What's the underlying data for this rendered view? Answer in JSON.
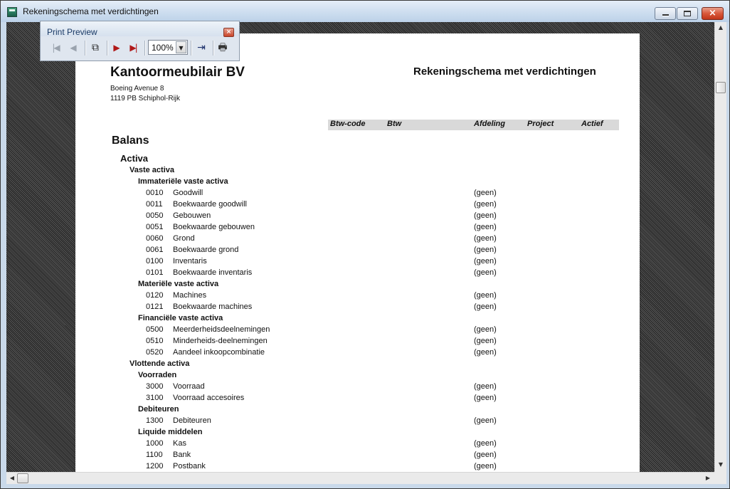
{
  "window": {
    "title": "Rekeningschema met verdichtingen",
    "colors": {
      "titlebar": "#c9d9ea",
      "close_button": "#c8452a",
      "workspace_pattern": "#3c3c3c"
    }
  },
  "toolbar": {
    "title": "Print Preview",
    "close_glyph": "×",
    "zoom": "100%",
    "buttons": [
      {
        "name": "first-page",
        "glyph": "|◀",
        "icon": "first-page-icon"
      },
      {
        "name": "previous-page",
        "glyph": "◀",
        "icon": "previous-page-icon"
      },
      {
        "name": "copy",
        "glyph": "⧉",
        "icon": "copy-pages-icon"
      },
      {
        "name": "next-page",
        "glyph": "▶",
        "icon": "next-page-icon"
      },
      {
        "name": "last-page",
        "glyph": "▶|",
        "icon": "last-page-icon"
      },
      {
        "name": "exit",
        "glyph": "⇥",
        "icon": "exit-door-icon"
      },
      {
        "name": "print",
        "glyph": "🖶",
        "icon": "printer-icon"
      }
    ]
  },
  "report": {
    "company": "Kantoormeubilair BV",
    "title": "Rekeningschema met verdichtingen",
    "address1": "Boeing Avenue 8",
    "address2": "1119 PB Schiphol-Rijk",
    "columns": [
      "Btw-code",
      "Btw",
      "Afdeling",
      "Project",
      "Actief"
    ],
    "sections": {
      "balans": "Balans",
      "activa": "Activa",
      "vaste_activa": "Vaste activa",
      "immaterieel": "Immateriële vaste activa",
      "materieel": "Materiële vaste activa",
      "financieel": "Financiële vaste activa",
      "vlottende_activa": "Vlottende activa",
      "voorraden": "Voorraden",
      "debiteuren": "Debiteuren",
      "liquide": "Liquide middelen"
    },
    "accounts": [
      {
        "code": "0010",
        "name": "Goodwill",
        "afdeling": "(geen)"
      },
      {
        "code": "0011",
        "name": "Boekwaarde goodwill",
        "afdeling": "(geen)"
      },
      {
        "code": "0050",
        "name": "Gebouwen",
        "afdeling": "(geen)"
      },
      {
        "code": "0051",
        "name": "Boekwaarde gebouwen",
        "afdeling": "(geen)"
      },
      {
        "code": "0060",
        "name": "Grond",
        "afdeling": "(geen)"
      },
      {
        "code": "0061",
        "name": "Boekwaarde grond",
        "afdeling": "(geen)"
      },
      {
        "code": "0100",
        "name": "Inventaris",
        "afdeling": "(geen)"
      },
      {
        "code": "0101",
        "name": "Boekwaarde inventaris",
        "afdeling": "(geen)"
      },
      {
        "code": "0120",
        "name": "Machines",
        "afdeling": "(geen)"
      },
      {
        "code": "0121",
        "name": "Boekwaarde machines",
        "afdeling": "(geen)"
      },
      {
        "code": "0500",
        "name": "Meerderheidsdeelnemingen",
        "afdeling": "(geen)"
      },
      {
        "code": "0510",
        "name": "Minderheids-deelnemingen",
        "afdeling": "(geen)"
      },
      {
        "code": "0520",
        "name": "Aandeel inkoopcombinatie",
        "afdeling": "(geen)"
      },
      {
        "code": "3000",
        "name": "Voorraad",
        "afdeling": "(geen)"
      },
      {
        "code": "3100",
        "name": "Voorraad accesoires",
        "afdeling": "(geen)"
      },
      {
        "code": "1300",
        "name": "Debiteuren",
        "afdeling": "(geen)"
      },
      {
        "code": "1000",
        "name": "Kas",
        "afdeling": "(geen)"
      },
      {
        "code": "1100",
        "name": "Bank",
        "afdeling": "(geen)"
      },
      {
        "code": "1200",
        "name": "Postbank",
        "afdeling": "(geen)"
      }
    ]
  },
  "scrollbars": {
    "up": "▲",
    "down": "▼",
    "left": "◀",
    "right": "▶"
  }
}
